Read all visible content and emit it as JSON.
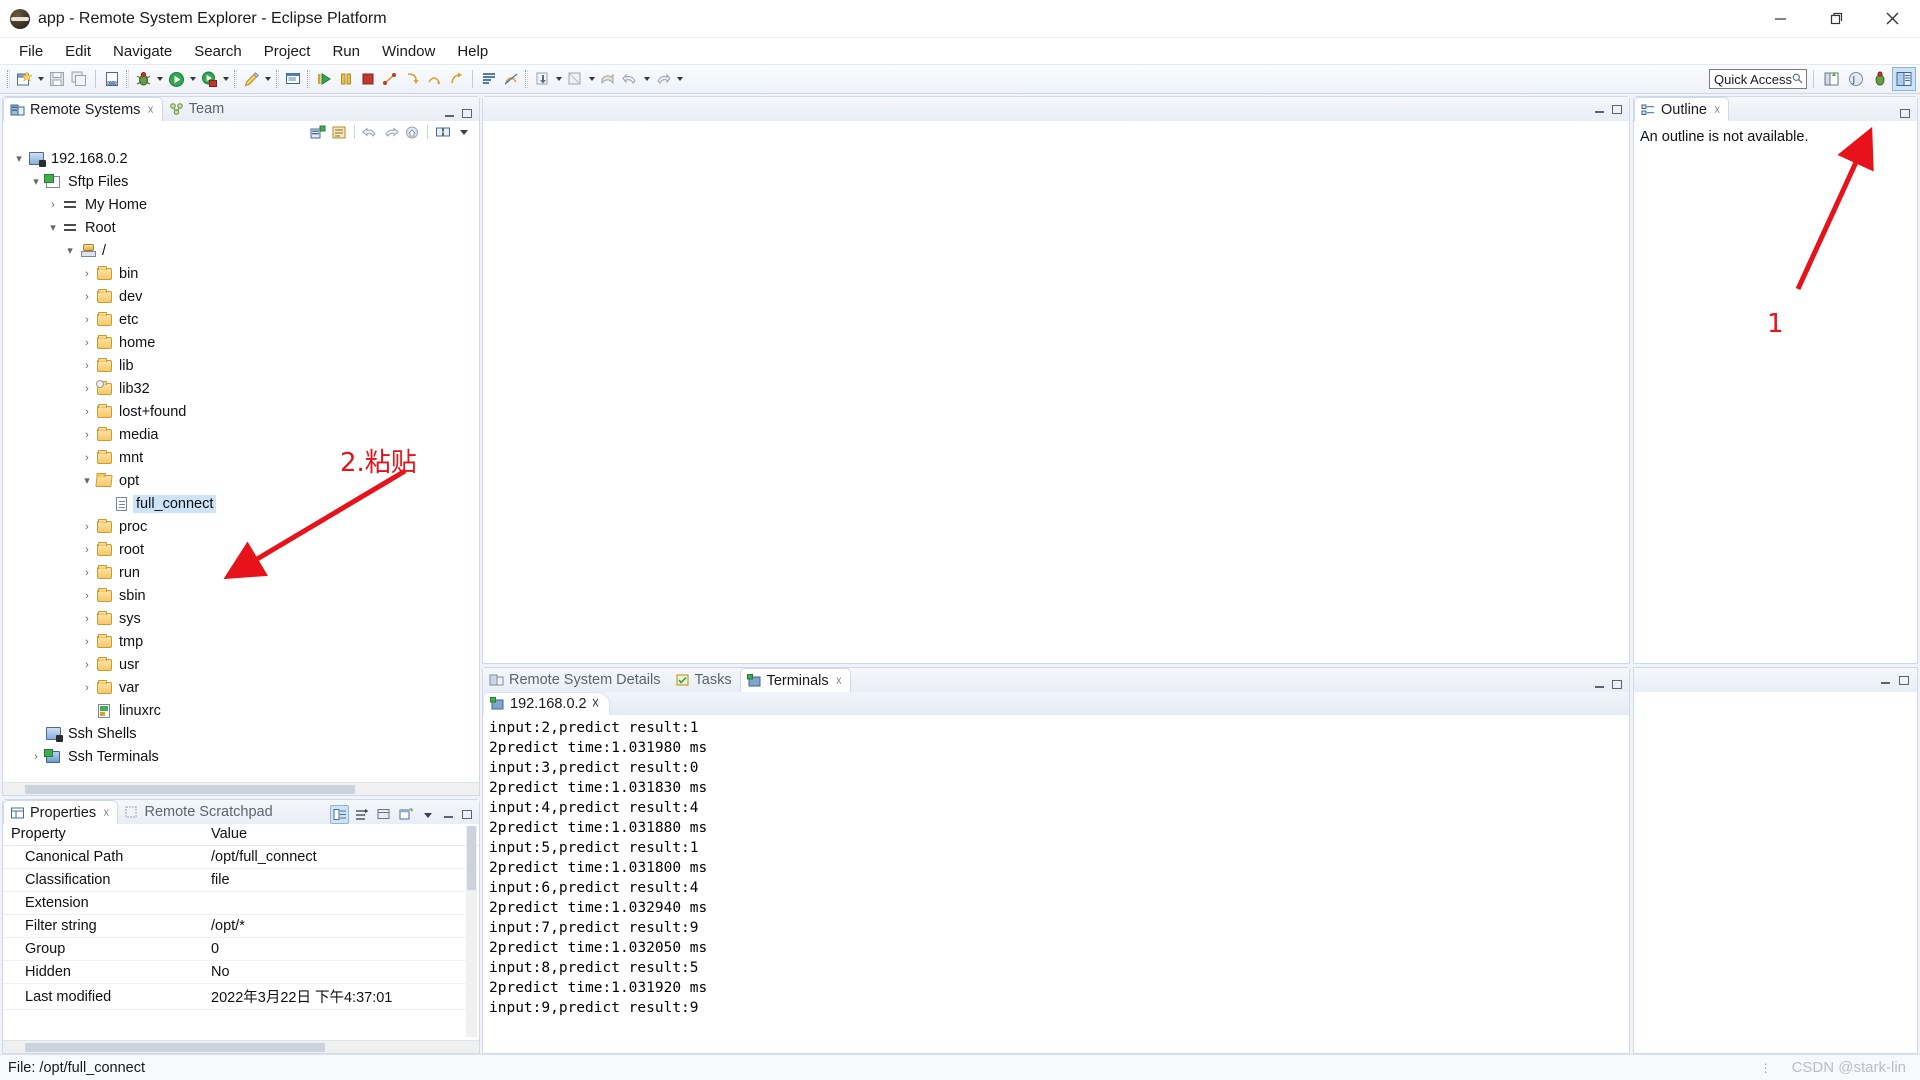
{
  "window": {
    "title": "app - Remote System Explorer - Eclipse Platform",
    "app_icon": "eclipse-icon",
    "minimize_label": "Minimize",
    "restore_label": "Restore",
    "close_label": "Close"
  },
  "menubar": {
    "items": [
      {
        "label": "File"
      },
      {
        "label": "Edit"
      },
      {
        "label": "Navigate"
      },
      {
        "label": "Search"
      },
      {
        "label": "Project"
      },
      {
        "label": "Run"
      },
      {
        "label": "Window"
      },
      {
        "label": "Help"
      }
    ]
  },
  "toolbar": {
    "quick_access_placeholder": "Quick Access",
    "quick_access_value": "",
    "groups": [
      [
        "new-wizard-icon",
        "dropdown",
        "save-icon",
        "save-all-icon"
      ],
      [
        "new-file-icon"
      ],
      [
        "debug-icon",
        "dropdown",
        "run-icon",
        "dropdown",
        "run-external-icon",
        "dropdown"
      ],
      [
        "edit-pencil-icon",
        "dropdown"
      ],
      [
        "console-icon"
      ],
      [
        "resume-icon",
        "suspend-icon",
        "terminate-icon",
        "disconnect-icon",
        "step-into-icon",
        "step-over-icon",
        "step-return-icon"
      ],
      [
        "show-whitespace-icon",
        "skip-breakpoints-icon"
      ],
      [
        "download-icon",
        "dropdown",
        "search-remote-icon",
        "dropdown",
        "previous-annotation-icon",
        "back-icon",
        "dropdown",
        "forward-icon",
        "dropdown"
      ]
    ],
    "perspective_buttons": [
      "open-perspective-icon",
      "java-perspective-icon",
      "debug-perspective-icon",
      "remote-system-explorer-perspective-icon"
    ]
  },
  "remote_systems": {
    "tabs": [
      {
        "label": "Remote Systems",
        "icon": "remote-systems-icon",
        "active": true,
        "closable": true
      },
      {
        "label": "Team",
        "icon": "team-icon",
        "active": false,
        "closable": false
      }
    ],
    "local_toolbar": [
      "define-connection-icon",
      "collapse-all-icon",
      "back-icon",
      "forward-icon",
      "home-icon",
      "link-editor-icon",
      "view-menu-icon"
    ],
    "tree": [
      {
        "label": "192.168.0.2",
        "icon": "connection-icon",
        "indent": 0,
        "twist": "expanded",
        "selected": false
      },
      {
        "label": "Sftp Files",
        "icon": "sftp-files-icon",
        "indent": 1,
        "twist": "expanded",
        "selected": false
      },
      {
        "label": "My Home",
        "icon": "filter-arrows-icon",
        "indent": 2,
        "twist": "collapsed",
        "selected": false
      },
      {
        "label": "Root",
        "icon": "filter-arrows-icon",
        "indent": 2,
        "twist": "expanded",
        "selected": false
      },
      {
        "label": "/",
        "icon": "root-folder-icon",
        "indent": 3,
        "twist": "expanded",
        "selected": false
      },
      {
        "label": "bin",
        "icon": "folder-icon",
        "indent": 4,
        "twist": "collapsed",
        "selected": false
      },
      {
        "label": "dev",
        "icon": "folder-icon",
        "indent": 4,
        "twist": "collapsed",
        "selected": false
      },
      {
        "label": "etc",
        "icon": "folder-icon",
        "indent": 4,
        "twist": "collapsed",
        "selected": false
      },
      {
        "label": "home",
        "icon": "folder-icon",
        "indent": 4,
        "twist": "collapsed",
        "selected": false
      },
      {
        "label": "lib",
        "icon": "folder-icon",
        "indent": 4,
        "twist": "collapsed",
        "selected": false
      },
      {
        "label": "lib32",
        "icon": "folder-link-icon",
        "indent": 4,
        "twist": "collapsed",
        "selected": false
      },
      {
        "label": "lost+found",
        "icon": "folder-icon",
        "indent": 4,
        "twist": "collapsed",
        "selected": false
      },
      {
        "label": "media",
        "icon": "folder-icon",
        "indent": 4,
        "twist": "collapsed",
        "selected": false
      },
      {
        "label": "mnt",
        "icon": "folder-icon",
        "indent": 4,
        "twist": "collapsed",
        "selected": false
      },
      {
        "label": "opt",
        "icon": "folder-open-icon",
        "indent": 4,
        "twist": "expanded",
        "selected": false
      },
      {
        "label": "full_connect",
        "icon": "file-icon",
        "indent": 5,
        "twist": "none",
        "selected": true
      },
      {
        "label": "proc",
        "icon": "folder-icon",
        "indent": 4,
        "twist": "collapsed",
        "selected": false
      },
      {
        "label": "root",
        "icon": "folder-icon",
        "indent": 4,
        "twist": "collapsed",
        "selected": false
      },
      {
        "label": "run",
        "icon": "folder-icon",
        "indent": 4,
        "twist": "collapsed",
        "selected": false
      },
      {
        "label": "sbin",
        "icon": "folder-icon",
        "indent": 4,
        "twist": "collapsed",
        "selected": false
      },
      {
        "label": "sys",
        "icon": "folder-icon",
        "indent": 4,
        "twist": "collapsed",
        "selected": false
      },
      {
        "label": "tmp",
        "icon": "folder-icon",
        "indent": 4,
        "twist": "collapsed",
        "selected": false
      },
      {
        "label": "usr",
        "icon": "folder-icon",
        "indent": 4,
        "twist": "collapsed",
        "selected": false
      },
      {
        "label": "var",
        "icon": "folder-icon",
        "indent": 4,
        "twist": "collapsed",
        "selected": false
      },
      {
        "label": "linuxrc",
        "icon": "script-file-icon",
        "indent": 4,
        "twist": "none",
        "selected": false
      },
      {
        "label": "Ssh Shells",
        "icon": "ssh-shells-icon",
        "indent": 1,
        "twist": "none",
        "selected": false
      },
      {
        "label": "Ssh Terminals",
        "icon": "ssh-terminals-icon",
        "indent": 1,
        "twist": "collapsed",
        "selected": false
      }
    ]
  },
  "properties": {
    "tabs": [
      {
        "label": "Properties",
        "icon": "properties-icon",
        "active": true,
        "closable": true
      },
      {
        "label": "Remote Scratchpad",
        "icon": "scratchpad-icon",
        "active": false,
        "closable": false
      }
    ],
    "toolbar": [
      "show-categories-icon",
      "show-advanced-icon",
      "restore-default-icon",
      "new-properties-view-icon",
      "view-menu-icon"
    ],
    "columns": [
      "Property",
      "Value"
    ],
    "rows": [
      {
        "name": "Canonical Path",
        "value": "/opt/full_connect"
      },
      {
        "name": "Classification",
        "value": "file"
      },
      {
        "name": "Extension",
        "value": ""
      },
      {
        "name": "Filter string",
        "value": "/opt/*"
      },
      {
        "name": "Group",
        "value": "0"
      },
      {
        "name": "Hidden",
        "value": "No"
      },
      {
        "name": "Last modified",
        "value": "2022年3月22日 下午4:37:01"
      }
    ]
  },
  "editor_area": {
    "empty": true
  },
  "outline": {
    "tabs": [
      {
        "label": "Outline",
        "icon": "outline-icon",
        "active": true,
        "closable": true
      }
    ],
    "message": "An outline is not available."
  },
  "bottom": {
    "tabs": [
      {
        "label": "Remote System Details",
        "icon": "remote-system-details-icon",
        "active": false,
        "closable": false
      },
      {
        "label": "Tasks",
        "icon": "tasks-icon",
        "active": false,
        "closable": false
      },
      {
        "label": "Terminals",
        "icon": "terminals-icon",
        "active": true,
        "closable": true
      }
    ],
    "terminal_session_tab": {
      "label": "192.168.0.2",
      "icon": "terminal-session-icon",
      "closable": true
    },
    "terminal_output": [
      "input:2,predict result:1",
      "2predict time:1.031980 ms",
      "input:3,predict result:0",
      "2predict time:1.031830 ms",
      "input:4,predict result:4",
      "2predict time:1.031880 ms",
      "input:5,predict result:1",
      "2predict time:1.031800 ms",
      "input:6,predict result:4",
      "2predict time:1.032940 ms",
      "input:7,predict result:9",
      "2predict time:1.032050 ms",
      "input:8,predict result:5",
      "2predict time:1.031920 ms",
      "input:9,predict result:9"
    ]
  },
  "statusbar": {
    "text": "File: /opt/full_connect",
    "watermark": "CSDN @stark-lin"
  },
  "annotations": [
    {
      "id": "annotation-1",
      "text": "1",
      "color": "#e8131a"
    },
    {
      "id": "annotation-2",
      "text": "2.粘贴",
      "color": "#e8131a"
    }
  ]
}
